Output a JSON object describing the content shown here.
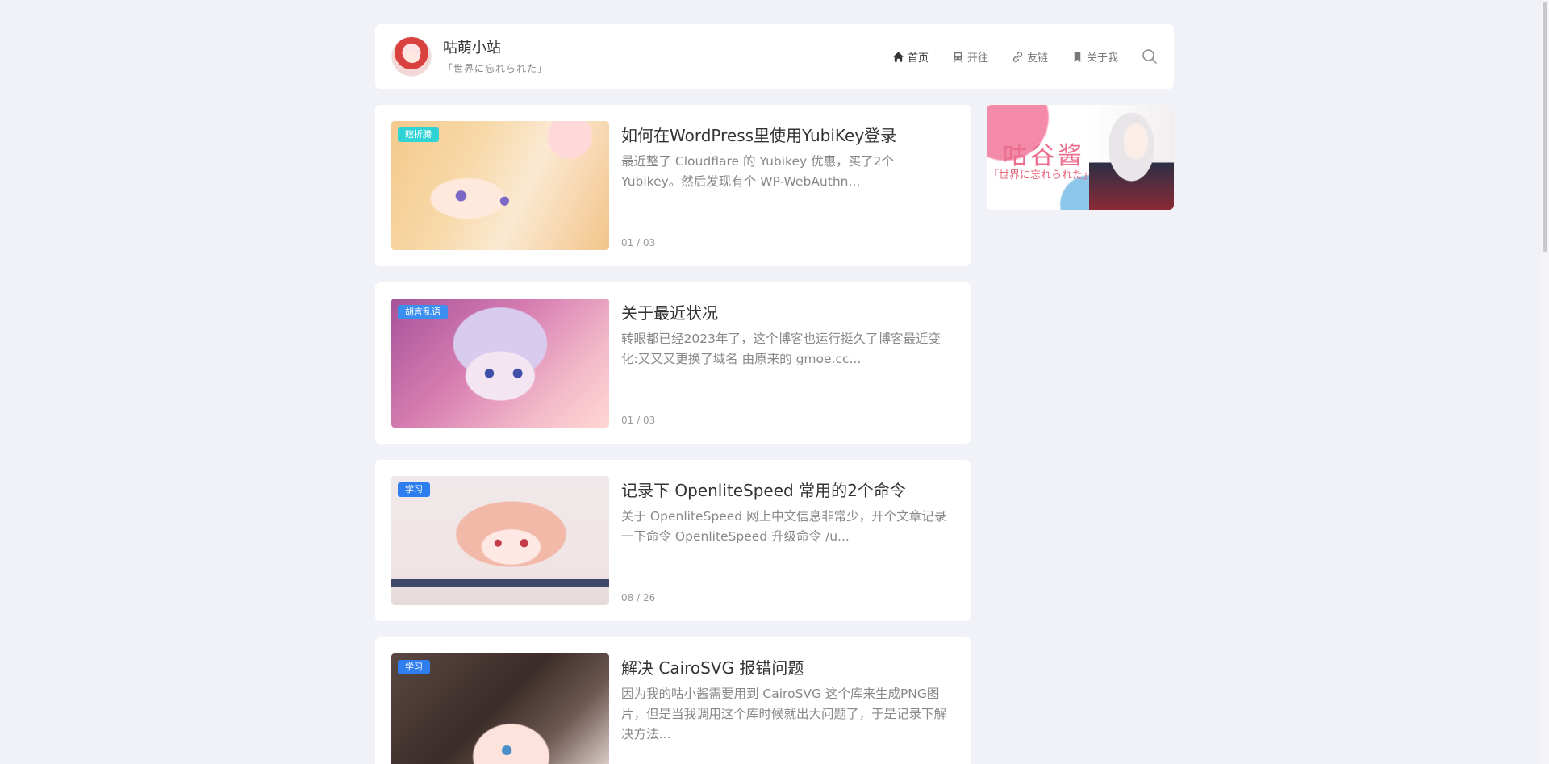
{
  "site": {
    "name": "咕萌小站",
    "tagline": "「世界に忘れられた」"
  },
  "nav": {
    "items": [
      {
        "label": "首页",
        "icon": "home-icon",
        "active": true
      },
      {
        "label": "开往",
        "icon": "train-icon",
        "active": false
      },
      {
        "label": "友链",
        "icon": "link-icon",
        "active": false
      },
      {
        "label": "关于我",
        "icon": "bookmark-icon",
        "active": false
      }
    ],
    "search_icon": "search-icon"
  },
  "posts": [
    {
      "tag": "瞎折腾",
      "tag_color": "#2fd3d3",
      "title": "如何在WordPress里使用YubiKey登录",
      "excerpt": "最近整了 Cloudflare 的 Yubikey 优惠，买了2个 Yubikey。然后发现有个 WP-WebAuthn...",
      "date": "01 / 03"
    },
    {
      "tag": "胡言乱语",
      "tag_color": "#3a8ff0",
      "title": "关于最近状况",
      "excerpt": "转眼都已经2023年了，这个博客也运行挺久了博客最近变化:又又又更换了域名 由原来的 gmoe.cc...",
      "date": "01 / 03"
    },
    {
      "tag": "学习",
      "tag_color": "#2f7ef0",
      "title": "记录下 OpenliteSpeed 常用的2个命令",
      "excerpt": "关于 OpenliteSpeed 网上中文信息非常少，开个文章记录一下命令 OpenliteSpeed 升级命令 /u...",
      "date": "08 / 26"
    },
    {
      "tag": "学习",
      "tag_color": "#2f7ef0",
      "title": "解决 CairoSVG 报错问题",
      "excerpt": "因为我的咕小酱需要用到 CairoSVG 这个库来生成PNG图片，但是当我调用这个库时候就出大问题了，于是记录下解决方法...",
      "date": ""
    }
  ],
  "sidebar": {
    "banner_title": "咕谷酱",
    "banner_subtitle": "「世界に忘れられた」"
  }
}
